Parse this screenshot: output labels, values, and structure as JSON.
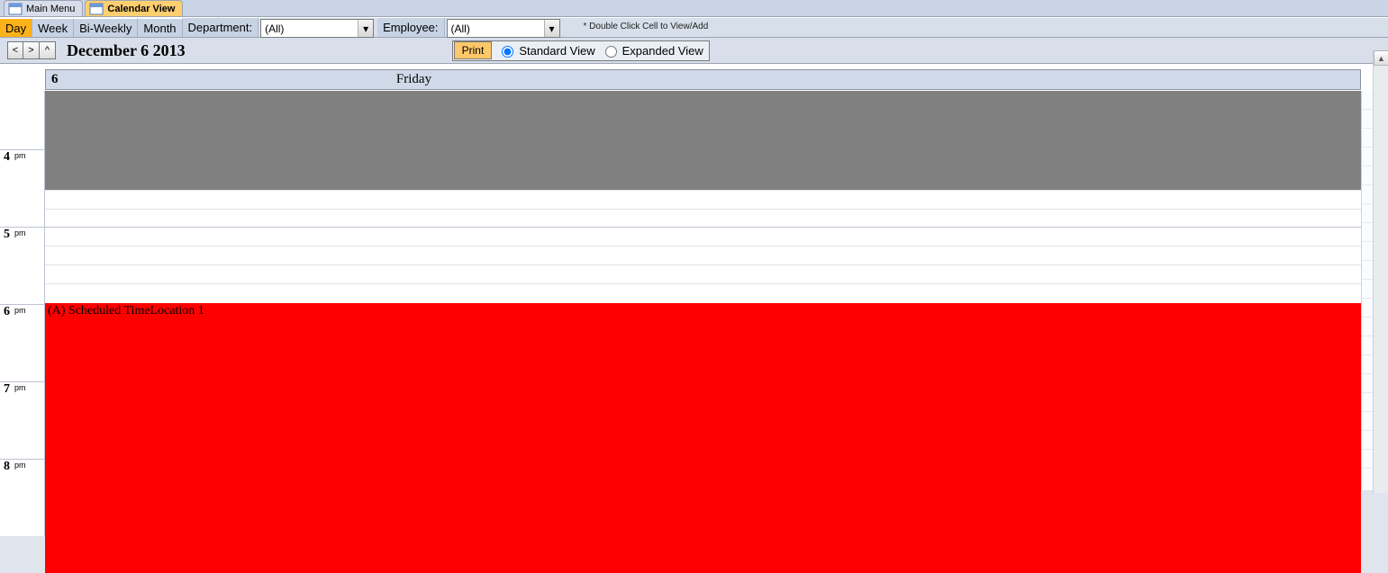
{
  "tabs": [
    {
      "label": "Main Menu",
      "active": false
    },
    {
      "label": "Calendar View",
      "active": true
    }
  ],
  "viewTabs": {
    "day": "Day",
    "week": "Week",
    "biweekly": "Bi-Weekly",
    "month": "Month"
  },
  "filters": {
    "departmentLabel": "Department:",
    "departmentValue": "(All)",
    "employeeLabel": "Employee:",
    "employeeValue": "(All)"
  },
  "hint": "* Double Click Cell to View/Add",
  "nav": {
    "prev": "<",
    "next": ">",
    "up": "^"
  },
  "dateTitle": "December 6 2013",
  "printLabel": "Print",
  "viewMode": {
    "standard": "Standard View",
    "expanded": "Expanded View"
  },
  "dayHeader": {
    "num": "6",
    "name": "Friday"
  },
  "timeLabels": {
    "h4": "4",
    "h5": "5",
    "h6": "6",
    "h7": "7",
    "h8": "8",
    "pm": "pm"
  },
  "events": {
    "red": "(A) Scheduled TimeLocation 1"
  },
  "scroll": {
    "up": "▲"
  },
  "dropdown": {
    "arrow": "▾"
  }
}
